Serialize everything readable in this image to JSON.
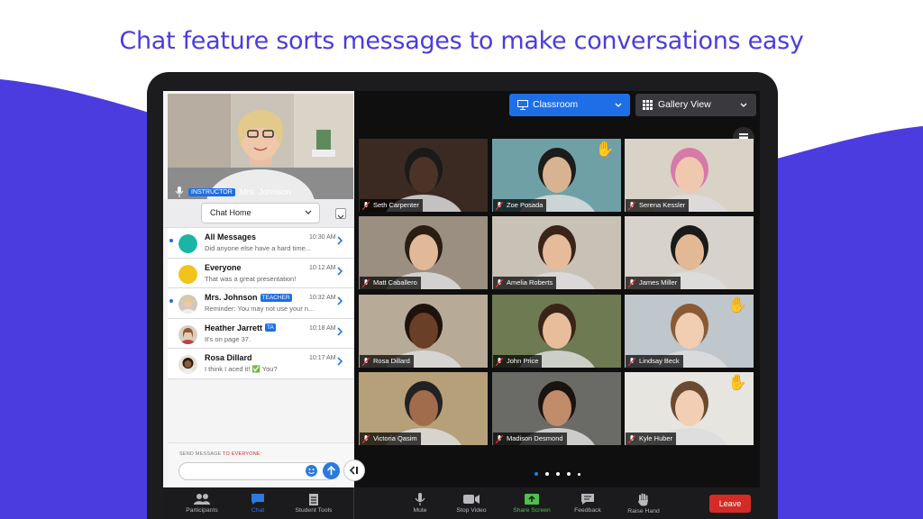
{
  "headline": "Chat feature sorts messages to make conversations easy",
  "colors": {
    "brand": "#4b3ce0",
    "accent": "#1e6ee8",
    "leave": "#d42b24",
    "share": "#4cc24c"
  },
  "instructor": {
    "badge": "INSTRUCTOR",
    "name": "Mrs. Johnson"
  },
  "chat": {
    "home_label": "Chat Home",
    "conversations": [
      {
        "title": "All Messages",
        "preview": "Did anyone else have a hard time...",
        "time": "10:30 AM",
        "unread": true,
        "avatar": "teal"
      },
      {
        "title": "Everyone",
        "preview": "That was a great presentation!",
        "time": "10:12 AM",
        "unread": false,
        "avatar": "yellow"
      },
      {
        "title": "Mrs. Johnson",
        "role": "TEACHER",
        "preview": "Reminder: You may not use your n...",
        "time": "10:32 AM",
        "unread": true,
        "avatar": "photo"
      },
      {
        "title": "Heather Jarrett",
        "role": "TA",
        "preview": "It's on page 37.",
        "time": "10:18 AM",
        "unread": false,
        "avatar": "photo"
      },
      {
        "title": "Rosa Dillard",
        "preview": "I think I aced it! ✅ You?",
        "time": "10:17 AM",
        "unread": false,
        "avatar": "photo"
      }
    ],
    "send_label_prefix": "SEND MESSAGE ",
    "send_label_target": "TO EVERYONE:",
    "input_value": ""
  },
  "view": {
    "classroom_label": "Classroom",
    "gallery_label": "Gallery View"
  },
  "participants": [
    {
      "name": "Seth Carpenter",
      "hand": false
    },
    {
      "name": "Zoe Posada",
      "hand": true
    },
    {
      "name": "Serena Kessler",
      "hand": false
    },
    {
      "name": "Matt Caballero",
      "hand": false
    },
    {
      "name": "Amelia Roberts",
      "hand": false
    },
    {
      "name": "James Miller",
      "hand": false
    },
    {
      "name": "Rosa Dillard",
      "hand": false
    },
    {
      "name": "John Price",
      "hand": false
    },
    {
      "name": "Lindsay Beck",
      "hand": true
    },
    {
      "name": "Victoria Qasim",
      "hand": false
    },
    {
      "name": "Madison Desmond",
      "hand": false
    },
    {
      "name": "Kyle Huber",
      "hand": true
    }
  ],
  "hand_glyph": "✋",
  "toolbar": {
    "participants": "Participants",
    "chat": "Chat",
    "student_tools": "Student Tools",
    "mute": "Mute",
    "stop_video": "Stop Video",
    "share_screen": "Share Screen",
    "feedback": "Feedback",
    "raise_hand": "Raise Hand",
    "leave": "Leave"
  }
}
